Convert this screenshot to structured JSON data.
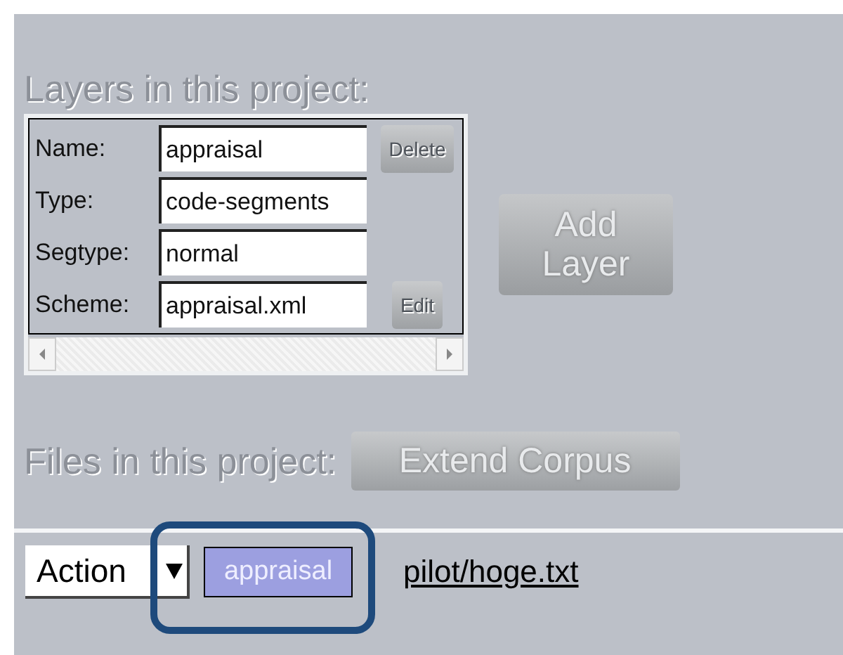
{
  "layers_heading": "Layers in this project:",
  "layer_form": {
    "fields": [
      {
        "label": "Name:",
        "value": "appraisal",
        "button": "Delete"
      },
      {
        "label": "Type:",
        "value": "code-segments"
      },
      {
        "label": "Segtype:",
        "value": "normal"
      },
      {
        "label": "Scheme:",
        "value": "appraisal.xml",
        "button": "Edit"
      }
    ]
  },
  "add_layer_button": "Add Layer",
  "files_heading": "Files in this project:",
  "extend_corpus_button": "Extend Corpus",
  "files": [
    {
      "action": "Action",
      "tag": "appraisal",
      "color": "#9c9fe0",
      "path": "pilot/hoge.txt"
    }
  ]
}
